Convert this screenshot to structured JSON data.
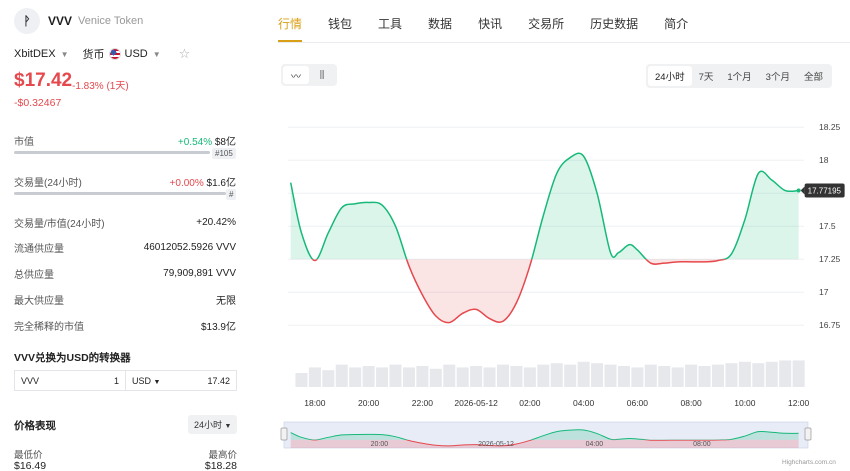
{
  "token": {
    "logo_text": "ᚹ",
    "symbol": "VVV",
    "name": "Venice Token"
  },
  "exchange": {
    "label": "XbitDEX",
    "currency_label": "货币",
    "currency": "USD"
  },
  "price": {
    "value": "$17.42",
    "change": "-1.83% (1天)",
    "abs_change": "-$0.32467"
  },
  "stats": {
    "market_cap": {
      "label": "市值",
      "change": "+0.54%",
      "value": "$8亿",
      "rank": "#105"
    },
    "volume": {
      "label": "交易量(24小时)",
      "change": "+0.00%",
      "value": "$1.6亿",
      "rank": "#"
    },
    "vol_mcap": {
      "label": "交易量/市值(24小时)",
      "value": "+20.42%"
    },
    "circulating": {
      "label": "流通供应量",
      "value": "46012052.5926 VVV"
    },
    "total": {
      "label": "总供应量",
      "value": "79,909,891 VVV"
    },
    "max": {
      "label": "最大供应量",
      "value": "无限"
    },
    "fdv": {
      "label": "完全稀释的市值",
      "value": "$13.9亿"
    }
  },
  "converter": {
    "title": "VVV兑换为USD的转换器",
    "from_symbol": "VVV",
    "from_amount": "1",
    "to_symbol": "USD",
    "to_amount": "17.42"
  },
  "performance": {
    "title": "价格表现",
    "period": "24小时",
    "low_label": "最低价",
    "high_label": "最高价",
    "low": "$16.49",
    "high": "$18.28"
  },
  "tabs": [
    "行情",
    "钱包",
    "工具",
    "数据",
    "快讯",
    "交易所",
    "历史数据",
    "简介"
  ],
  "ranges": [
    "24小时",
    "7天",
    "1个月",
    "3个月",
    "全部"
  ],
  "colors": {
    "accent": "#d9a017",
    "up": "#16b979",
    "down": "#e5484d"
  },
  "chart_data": {
    "type": "area",
    "baseline": 17.25,
    "y_ticks": [
      16.75,
      17,
      17.25,
      17.5,
      17.75,
      18,
      18.25
    ],
    "ylim": [
      16.6,
      18.35
    ],
    "x_ticks": [
      "18:00",
      "20:00",
      "22:00",
      "2026-05-12",
      "02:00",
      "04:00",
      "06:00",
      "08:00",
      "10:00",
      "12:00"
    ],
    "x_tick_hours": [
      18,
      20,
      22,
      24,
      26,
      28,
      30,
      32,
      34,
      36
    ],
    "current_label": "17.77195",
    "x_hours": [
      17.1,
      17.5,
      18.0,
      18.5,
      19.0,
      19.5,
      20.0,
      20.5,
      21.0,
      21.5,
      22.0,
      22.5,
      23.0,
      23.5,
      24.0,
      24.5,
      25.0,
      25.5,
      26.0,
      26.5,
      27.0,
      27.5,
      28.0,
      28.5,
      29.0,
      29.3,
      29.7,
      30.0,
      30.5,
      31.0,
      31.5,
      32.0,
      32.5,
      33.0,
      33.5,
      34.0,
      34.5,
      35.0,
      35.5,
      36.0
    ],
    "y_values": [
      17.83,
      17.45,
      17.24,
      17.45,
      17.64,
      17.67,
      17.68,
      17.66,
      17.5,
      17.2,
      16.98,
      16.82,
      16.77,
      16.84,
      16.87,
      16.8,
      16.78,
      16.92,
      17.2,
      17.58,
      17.9,
      18.02,
      18.03,
      17.75,
      17.3,
      17.3,
      17.36,
      17.32,
      17.22,
      17.22,
      17.23,
      17.23,
      17.23,
      17.24,
      17.29,
      17.55,
      17.9,
      17.85,
      17.77,
      17.77
    ],
    "volume_hours": [
      17.5,
      18.0,
      18.5,
      19.0,
      19.5,
      20.0,
      20.5,
      21.0,
      21.5,
      22.0,
      22.5,
      23.0,
      23.5,
      24.0,
      24.5,
      25.0,
      25.5,
      26.0,
      26.5,
      27.0,
      27.5,
      28.0,
      28.5,
      29.0,
      29.5,
      30.0,
      30.5,
      31.0,
      31.5,
      32.0,
      32.5,
      33.0,
      33.5,
      34.0,
      34.5,
      35.0,
      35.5,
      36.0
    ],
    "volumes": [
      0.5,
      0.7,
      0.6,
      0.8,
      0.7,
      0.75,
      0.7,
      0.8,
      0.7,
      0.75,
      0.65,
      0.8,
      0.7,
      0.75,
      0.7,
      0.8,
      0.75,
      0.7,
      0.8,
      0.85,
      0.8,
      0.9,
      0.85,
      0.8,
      0.75,
      0.7,
      0.8,
      0.75,
      0.7,
      0.8,
      0.75,
      0.8,
      0.85,
      0.9,
      0.85,
      0.9,
      0.95,
      0.95
    ],
    "navigator_ticks": [
      "20:00",
      "2026-05-12",
      "04:00",
      "08:00"
    ],
    "credits": "Highcharts.com.cn"
  }
}
